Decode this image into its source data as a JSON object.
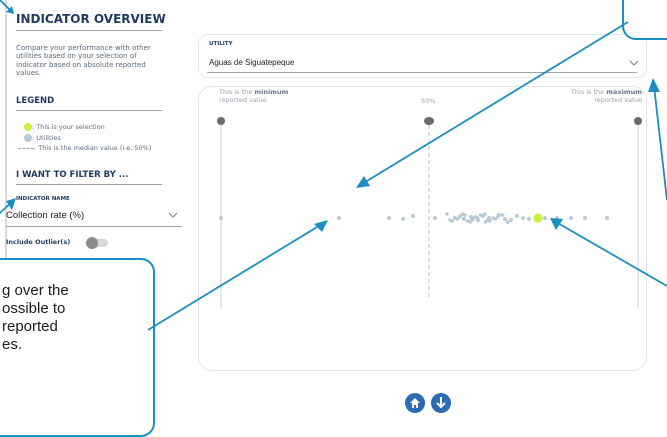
{
  "panel": {
    "title": "INDICATOR OVERVIEW",
    "description_lines": [
      "Compare your performance with other",
      "utilities based on your selection of",
      "indicator based on absolute reported",
      "values."
    ],
    "legend_heading": "LEGEND",
    "legend": [
      {
        "label": ": This is your selection",
        "color": "#c8f03c"
      },
      {
        "label": ": Utilities",
        "color": "#b8cad6"
      },
      {
        "label": ": This is the median value (i.e. 50%)"
      }
    ],
    "filter_heading": "I WANT TO FILTER BY ...",
    "indicator_name_label": "INDICATOR NAME",
    "indicator_value": "Collection rate (%)",
    "outlier_label": "Include Outlier(s)",
    "outlier_on": false
  },
  "utility": {
    "label": "UTILITY",
    "value": "Aguas de Siguatepeque"
  },
  "chart": {
    "min_label_parts": [
      "This is the ",
      "minimum"
    ],
    "min_label_line2": "reported value",
    "mid_label": "50%",
    "max_label_parts": [
      "This is the ",
      "maximum"
    ],
    "max_label_line2": "reported value"
  },
  "callout": {
    "lines": [
      "g over the",
      "ossible to",
      "reported",
      "es."
    ]
  },
  "colors": {
    "accent": "#1a8fbf",
    "navy": "#1f3a5f",
    "selection": "#c8f03c",
    "utility_dot": "#b8cad6"
  }
}
